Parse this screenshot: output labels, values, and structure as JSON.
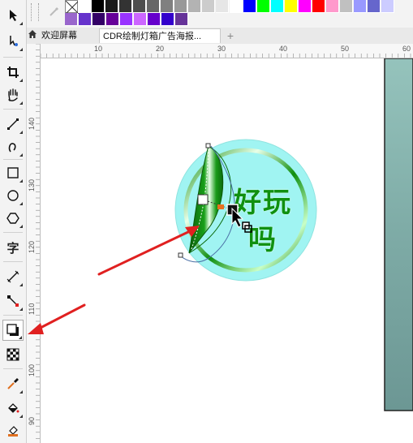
{
  "colors": {
    "palette_row1": [
      "#ffffff",
      "#000000",
      "#1a1a1a",
      "#333333",
      "#4d4d4d",
      "#666666",
      "#808080",
      "#999999",
      "#b3b3b3",
      "#cccccc",
      "#e6e6e6",
      "#ffffff",
      "#0000ff",
      "#00ff00",
      "#00ffff",
      "#ffff00",
      "#ff00ff",
      "#ff0000",
      "#ff99cc",
      "#c0c0c0",
      "#9999ff",
      "#6666cc",
      "#ccccff"
    ],
    "palette_row2": [
      "#9966cc",
      "#6633cc",
      "#330066",
      "#660099",
      "#9933ff",
      "#cc66ff",
      "#6600cc",
      "#3300cc",
      "#663399"
    ],
    "accent_arrow": "#e02020",
    "badge_circle": "#a0f4f2",
    "badge_ring": "#119911",
    "leaf_green": "#0c7a0c",
    "poster_bg": "#8fbab4"
  },
  "tabs": [
    {
      "label": "欢迎屏幕",
      "icon": "home-icon"
    },
    {
      "label": "CDR绘制灯箱广告海报..."
    }
  ],
  "rulers": {
    "h_labels": [
      "10",
      "20",
      "30",
      "40",
      "50",
      "60"
    ],
    "v_labels": [
      "140",
      "130",
      "120",
      "110",
      "100",
      "90"
    ]
  },
  "artwork": {
    "text_line1": "好玩",
    "text_line2": "吗"
  },
  "toolbox": [
    {
      "name": "pick-tool",
      "icon": "pointer-icon"
    },
    {
      "name": "shape-tool",
      "icon": "shape-edit-icon"
    },
    {
      "name": "crop-tool",
      "icon": "crop-icon"
    },
    {
      "name": "pan-tool",
      "icon": "hand-icon"
    },
    {
      "name": "freehand-tool",
      "icon": "freehand-icon"
    },
    {
      "name": "artistic-media-tool",
      "icon": "brush-curve-icon"
    },
    {
      "name": "rectangle-tool",
      "icon": "rectangle-icon"
    },
    {
      "name": "ellipse-tool",
      "icon": "ellipse-icon"
    },
    {
      "name": "polygon-tool",
      "icon": "polygon-icon"
    },
    {
      "name": "text-tool",
      "icon": "text-icon",
      "label": "字"
    },
    {
      "name": "parallel-dimension-tool",
      "icon": "dimension-line-icon"
    },
    {
      "name": "connector-tool",
      "icon": "connector-icon"
    },
    {
      "name": "drop-shadow-tool",
      "icon": "drop-shadow-icon"
    },
    {
      "name": "transparency-tool",
      "icon": "checkerboard-icon"
    },
    {
      "name": "eyedropper-tool",
      "icon": "eyedropper-icon"
    },
    {
      "name": "interactive-fill-tool",
      "icon": "paint-bucket-icon"
    },
    {
      "name": "smart-fill-tool",
      "icon": "smart-fill-icon"
    }
  ]
}
